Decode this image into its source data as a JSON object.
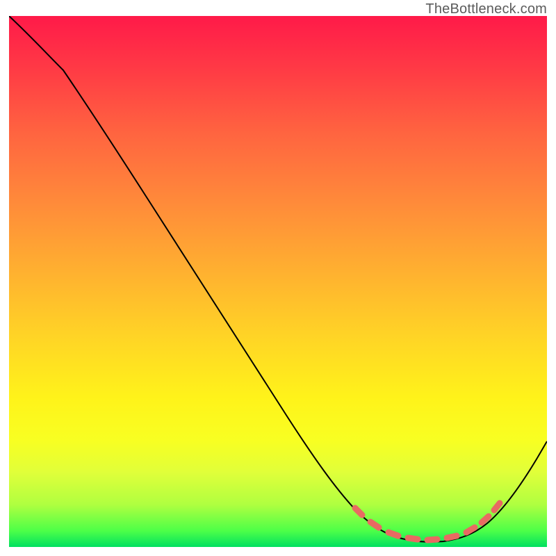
{
  "watermark": "TheBottleneck.com",
  "chart_data": {
    "type": "line",
    "title": "",
    "xlabel": "",
    "ylabel": "",
    "xlim": [
      0,
      100
    ],
    "ylim": [
      0,
      100
    ],
    "grid": false,
    "legend": false,
    "background": "vertical-gradient red→orange→yellow→green",
    "series": [
      {
        "name": "bottleneck-curve",
        "x": [
          0,
          5,
          10,
          15,
          20,
          25,
          30,
          35,
          40,
          45,
          50,
          55,
          60,
          63,
          66,
          69,
          72,
          75,
          78,
          81,
          84,
          87,
          90,
          93,
          96,
          100
        ],
        "y": [
          100,
          96,
          91,
          85,
          78.5,
          72,
          65,
          58,
          51,
          44,
          37,
          30,
          23,
          17.5,
          12.5,
          8.5,
          5.5,
          3.5,
          2.3,
          1.8,
          1.8,
          2.6,
          4.5,
          8,
          13,
          21
        ]
      }
    ],
    "annotations": [
      {
        "name": "highlight-dots",
        "description": "salmon dashed/dotted overlay along the valley of the curve",
        "x_range": [
          64,
          92
        ],
        "style": "thick-salmon-dashes"
      }
    ]
  }
}
